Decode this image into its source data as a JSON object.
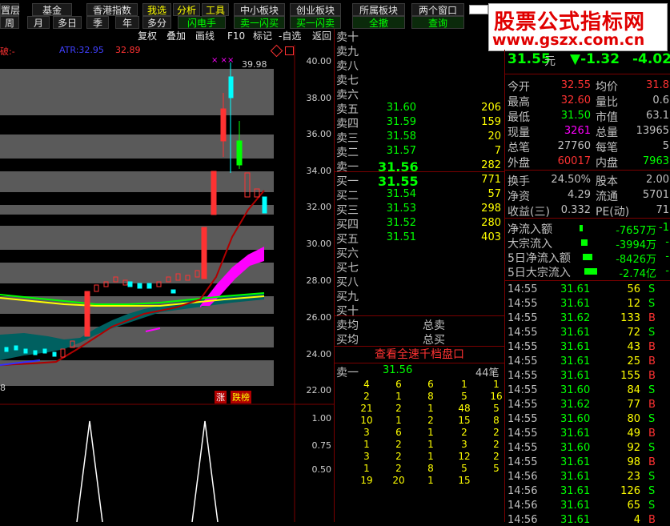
{
  "toolbar": {
    "row1": [
      "置层",
      "基金",
      "香港指数",
      "我选",
      "分析",
      "工具",
      "中小板块",
      "创业板块",
      "所属板块",
      "两个窗口"
    ],
    "row2": [
      "周",
      "月",
      "多日",
      "季",
      "年",
      "多分",
      "闪电手",
      "卖一闪买",
      "买一闪卖",
      "全撤",
      "查询"
    ],
    "row3": [
      "复权",
      "叠加",
      "画线",
      "F10",
      "标记",
      "-自选",
      "返回"
    ]
  },
  "logo": {
    "line1": "股票公式指标网",
    "line2": "www.gszx.com.cn"
  },
  "chart": {
    "indicator_label": "破:-",
    "ma_label": "ATR:32.95",
    "ma_value": "32.89",
    "high_label": "39.98",
    "price_axis": [
      "40.00",
      "38.00",
      "36.00",
      "34.00",
      "32.00",
      "30.00",
      "28.00",
      "26.00",
      "24.00",
      "22.00"
    ],
    "sub_axis": [
      "1.00",
      "0.75",
      "0.50"
    ],
    "left_marker": "8",
    "badge_up": "涨",
    "badge_rank": "跌榜"
  },
  "orderbook": {
    "sell": [
      {
        "label": "卖十",
        "price": "",
        "vol": ""
      },
      {
        "label": "卖九",
        "price": "",
        "vol": ""
      },
      {
        "label": "卖八",
        "price": "",
        "vol": ""
      },
      {
        "label": "卖七",
        "price": "",
        "vol": ""
      },
      {
        "label": "卖六",
        "price": "",
        "vol": ""
      },
      {
        "label": "卖五",
        "price": "31.60",
        "vol": "206"
      },
      {
        "label": "卖四",
        "price": "31.59",
        "vol": "159"
      },
      {
        "label": "卖三",
        "price": "31.58",
        "vol": "20"
      },
      {
        "label": "卖二",
        "price": "31.57",
        "vol": "7"
      },
      {
        "label": "卖一",
        "price": "31.56",
        "vol": "282"
      }
    ],
    "buy": [
      {
        "label": "买一",
        "price": "31.55",
        "vol": "771"
      },
      {
        "label": "买二",
        "price": "31.54",
        "vol": "57"
      },
      {
        "label": "买三",
        "price": "31.53",
        "vol": "298"
      },
      {
        "label": "买四",
        "price": "31.52",
        "vol": "280"
      },
      {
        "label": "买五",
        "price": "31.51",
        "vol": "403"
      },
      {
        "label": "买六",
        "price": "",
        "vol": ""
      },
      {
        "label": "买七",
        "price": "",
        "vol": ""
      },
      {
        "label": "买八",
        "price": "",
        "vol": ""
      },
      {
        "label": "买九",
        "price": "",
        "vol": ""
      },
      {
        "label": "买十",
        "price": "",
        "vol": ""
      }
    ],
    "avg_sell": "卖均",
    "avg_buy": "买均",
    "total_sell": "总卖",
    "total_buy": "总买",
    "depth_button": "查看全速千档盘口",
    "queue_label": "卖一",
    "queue_price": "31.56",
    "queue_count": "44笔",
    "queue": [
      [
        "4",
        "6",
        "6",
        "1",
        "1"
      ],
      [
        "2",
        "1",
        "8",
        "5",
        "16"
      ],
      [
        "21",
        "2",
        "1",
        "48",
        "5"
      ],
      [
        "10",
        "1",
        "2",
        "15",
        "8"
      ],
      [
        "3",
        "6",
        "1",
        "2",
        "2"
      ],
      [
        "1",
        "2",
        "1",
        "3",
        "2"
      ],
      [
        "3",
        "2",
        "1",
        "12",
        "2"
      ],
      [
        "1",
        "2",
        "8",
        "5",
        "5"
      ],
      [
        "19",
        "20",
        "1",
        "15",
        ""
      ]
    ]
  },
  "quote": {
    "price": "31.55",
    "unit": "元",
    "change": "▼-1.32",
    "change_pct": "-4.02",
    "fields": [
      {
        "l": "今开",
        "v": "32.55",
        "l2": "均价",
        "v2": "31.8"
      },
      {
        "l": "最高",
        "v": "32.60",
        "l2": "量比",
        "v2": "0.6"
      },
      {
        "l": "最低",
        "v": "31.50",
        "l2": "市值",
        "v2": "63.1"
      },
      {
        "l": "现量",
        "v": "3261",
        "l2": "总量",
        "v2": "13965"
      },
      {
        "l": "总笔",
        "v": "27760",
        "l2": "每笔",
        "v2": "5"
      },
      {
        "l": "外盘",
        "v": "60017",
        "l2": "内盘",
        "v2": "7963"
      }
    ],
    "fields2": [
      {
        "l": "换手",
        "v": "24.50%",
        "l2": "股本",
        "v2": "2.00"
      },
      {
        "l": "净资",
        "v": "4.29",
        "l2": "流通",
        "v2": "5701"
      },
      {
        "l": "收益(三)",
        "v": "0.332",
        "l2": "PE(动)",
        "v2": "71"
      }
    ],
    "flows": [
      {
        "l": "净流入额",
        "v": "-7657万",
        "v2": "-1"
      },
      {
        "l": "大宗流入",
        "v": "-3994万",
        "v2": "-"
      },
      {
        "l": "5日净流入额",
        "v": "-8426万",
        "v2": "-"
      },
      {
        "l": "5日大宗流入",
        "v": "-2.74亿",
        "v2": "-"
      }
    ]
  },
  "ticks": [
    {
      "t": "14:55",
      "p": "31.61",
      "v": "56",
      "s": "S"
    },
    {
      "t": "14:55",
      "p": "31.61",
      "v": "12",
      "s": "S"
    },
    {
      "t": "14:55",
      "p": "31.62",
      "v": "133",
      "s": "B"
    },
    {
      "t": "14:55",
      "p": "31.61",
      "v": "72",
      "s": "S"
    },
    {
      "t": "14:55",
      "p": "31.61",
      "v": "43",
      "s": "B"
    },
    {
      "t": "14:55",
      "p": "31.61",
      "v": "25",
      "s": "B"
    },
    {
      "t": "14:55",
      "p": "31.61",
      "v": "155",
      "s": "B"
    },
    {
      "t": "14:55",
      "p": "31.60",
      "v": "84",
      "s": "S"
    },
    {
      "t": "14:55",
      "p": "31.62",
      "v": "77",
      "s": "B"
    },
    {
      "t": "14:55",
      "p": "31.60",
      "v": "80",
      "s": "S"
    },
    {
      "t": "14:55",
      "p": "31.61",
      "v": "49",
      "s": "B"
    },
    {
      "t": "14:55",
      "p": "31.60",
      "v": "92",
      "s": "S"
    },
    {
      "t": "14:55",
      "p": "31.61",
      "v": "98",
      "s": "B"
    },
    {
      "t": "14:56",
      "p": "31.61",
      "v": "23",
      "s": "S"
    },
    {
      "t": "14:56",
      "p": "31.61",
      "v": "126",
      "s": "S"
    },
    {
      "t": "14:56",
      "p": "31.61",
      "v": "65",
      "s": "S"
    },
    {
      "t": "14:56",
      "p": "31.61",
      "v": "4",
      "s": "B"
    }
  ],
  "colors": {
    "up": "#ff3232",
    "down": "#00ff00",
    "neutral": "#c0c0c0",
    "yellow": "#ffff00",
    "magenta": "#ff00ff"
  }
}
